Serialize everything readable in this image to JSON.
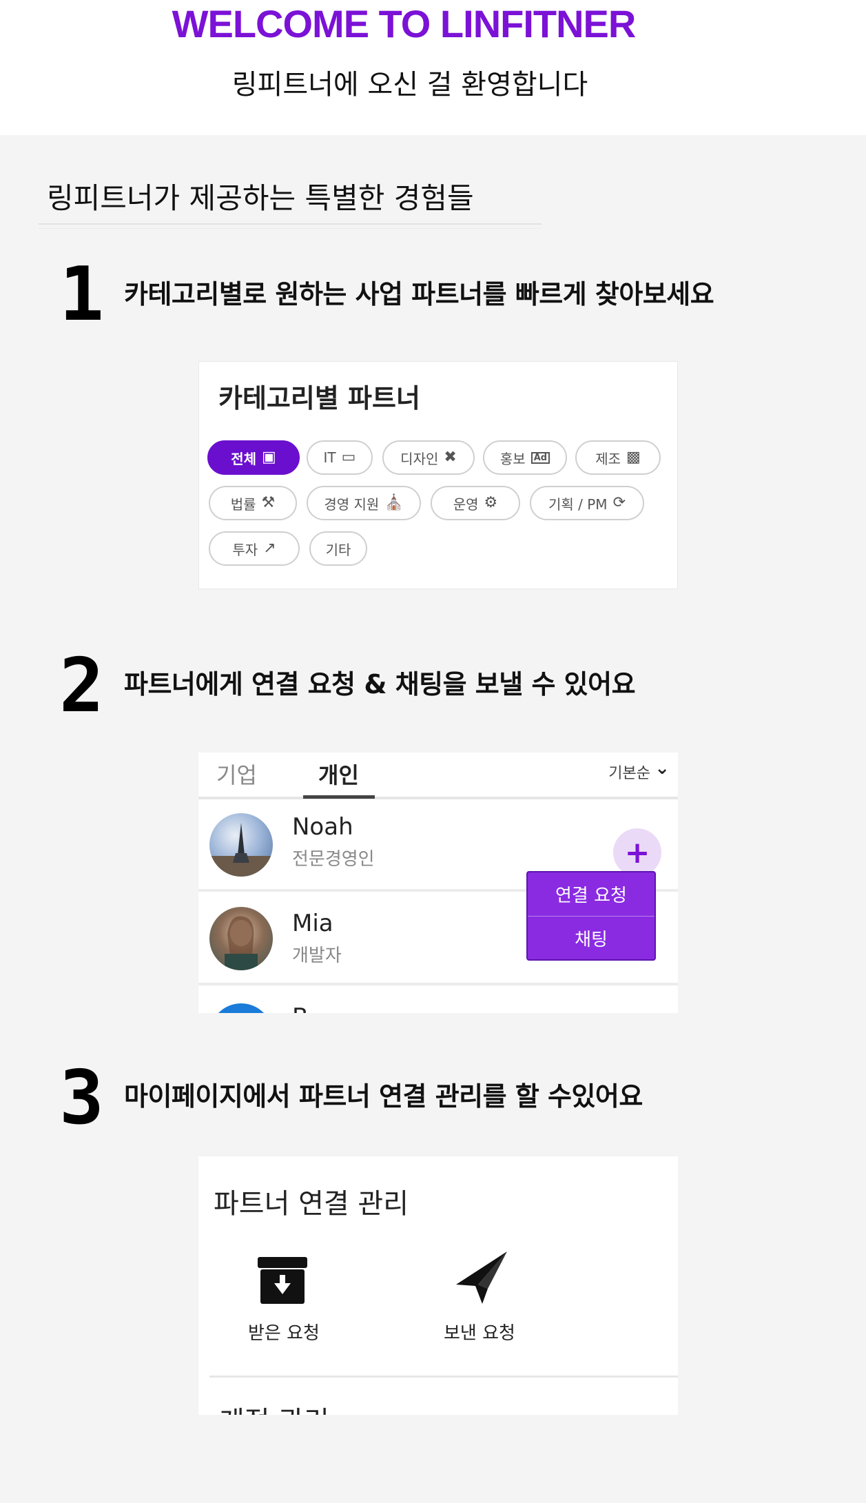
{
  "header": {
    "title": "WELCOME TO LINFITNER",
    "subtitle": "링피트너에 오신 걸 환영합니다"
  },
  "section": {
    "title": "링피트너가 제공하는 특별한 경험들"
  },
  "steps": [
    {
      "number": "1",
      "text": "카테고리별로 원하는 사업 파트너를 빠르게 찾아보세요"
    },
    {
      "number": "2",
      "text": "파트너에게 연결 요청 & 채팅을 보낼 수 있어요"
    },
    {
      "number": "3",
      "text": "마이페이지에서 파트너 연결 관리를 할 수있어요"
    }
  ],
  "category_card": {
    "title": "카테고리별 파트너",
    "chips": [
      {
        "label": "전체",
        "icon": "inbox-icon",
        "active": true
      },
      {
        "label": "IT",
        "icon": "laptop-icon"
      },
      {
        "label": "디자인",
        "icon": "design-tools-icon"
      },
      {
        "label": "홍보",
        "icon": "ad-icon"
      },
      {
        "label": "제조",
        "icon": "factory-icon"
      },
      {
        "label": "법률",
        "icon": "gavel-icon"
      },
      {
        "label": "경영 지원",
        "icon": "bank-icon"
      },
      {
        "label": "운영",
        "icon": "gear-icon"
      },
      {
        "label": "기획 / PM",
        "icon": "cycle-icon"
      },
      {
        "label": "투자",
        "icon": "chart-up-icon"
      },
      {
        "label": "기타",
        "icon": ""
      }
    ]
  },
  "partner_card": {
    "tabs": [
      "기업",
      "개인"
    ],
    "active_tab": "개인",
    "sort_label": "기본순",
    "partners": [
      {
        "name": "Noah",
        "role": "전문경영인"
      },
      {
        "name": "Mia",
        "role": "개발자"
      },
      {
        "name": "B",
        "role": ""
      }
    ],
    "action_menu": [
      "연결 요청",
      "채팅"
    ],
    "accent": "#8a2be2"
  },
  "manage_card": {
    "title": "파트너 연결 관리",
    "items": [
      {
        "label": "받은 요청",
        "icon": "inbox-download-icon"
      },
      {
        "label": "보낸 요청",
        "icon": "send-plane-icon"
      }
    ],
    "cut_label": "계정 관리"
  },
  "colors": {
    "brand": "#7b12d6",
    "chip_active": "#6b0fcf",
    "background": "#f4f4f4"
  }
}
